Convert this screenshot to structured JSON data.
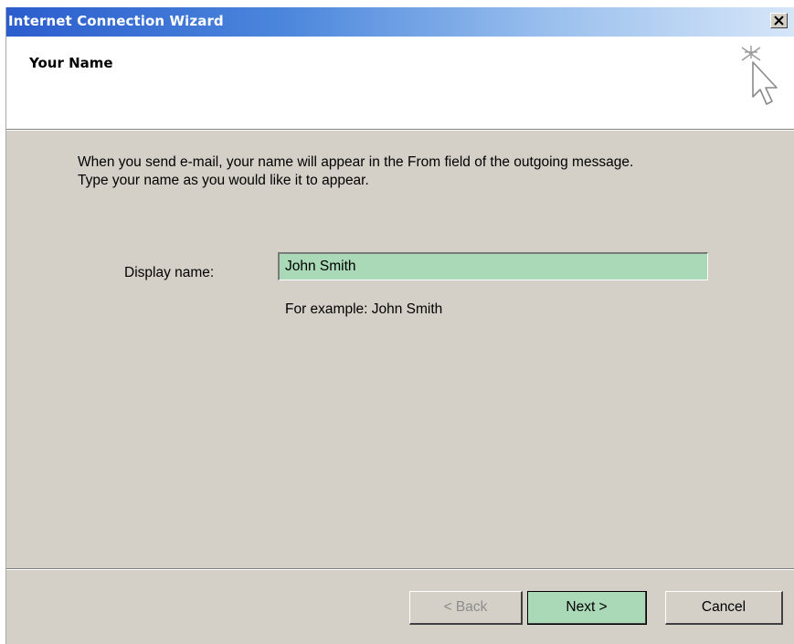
{
  "window": {
    "title": "Internet Connection Wizard",
    "close_icon": "close-icon"
  },
  "header": {
    "title": "Your Name",
    "icon": "wizard-cursor-icon"
  },
  "body": {
    "intro_line1": "When you send e-mail, your name will appear in the From field of the outgoing message.",
    "intro_line2": "Type your name as you would like it to appear.",
    "display_name_label": "Display name:",
    "display_name_value": "John Smith",
    "example_text": "For example: John Smith"
  },
  "buttons": {
    "back_label": "< Back",
    "next_label": "Next >",
    "cancel_label": "Cancel"
  },
  "colors": {
    "titlebar_start": "#2b5dcd",
    "highlight_green": "#a9d9b6",
    "dialog_gray": "#d4d0c8"
  }
}
